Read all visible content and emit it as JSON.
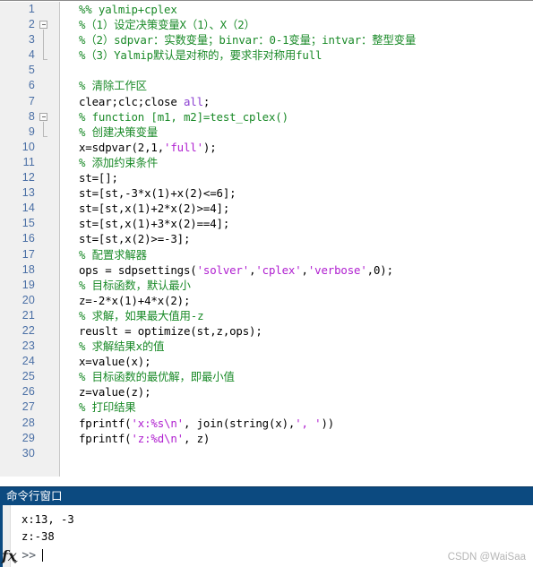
{
  "editor": {
    "first_line": 1,
    "last_line": 30,
    "total_lines": 30,
    "fold_markers": [
      2,
      8
    ],
    "lines": [
      {
        "n": 1,
        "tokens": [
          {
            "t": "%% yalmip+cplex",
            "c": "cm"
          }
        ]
      },
      {
        "n": 2,
        "tokens": [
          {
            "t": "%（1）设定决策变量X（1）、X（2）",
            "c": "cm"
          }
        ]
      },
      {
        "n": 3,
        "tokens": [
          {
            "t": "%（2）sdpvar：实数变量；binvar：0-1变量；intvar：整型变量",
            "c": "cm"
          }
        ]
      },
      {
        "n": 4,
        "tokens": [
          {
            "t": "%（3）Yalmip默认是对称的，要求非对称用full",
            "c": "cm"
          }
        ]
      },
      {
        "n": 5,
        "tokens": []
      },
      {
        "n": 6,
        "tokens": [
          {
            "t": "% 清除工作区",
            "c": "cm"
          }
        ]
      },
      {
        "n": 7,
        "tokens": [
          {
            "t": "clear;clc;close ",
            "c": "pl"
          },
          {
            "t": "all",
            "c": "kw"
          },
          {
            "t": ";",
            "c": "pl"
          }
        ]
      },
      {
        "n": 8,
        "tokens": [
          {
            "t": "% function [m1, m2]=test_cplex()",
            "c": "cm"
          }
        ]
      },
      {
        "n": 9,
        "tokens": [
          {
            "t": "% 创建决策变量",
            "c": "cm"
          }
        ]
      },
      {
        "n": 10,
        "tokens": [
          {
            "t": "x=sdpvar(2,1,",
            "c": "pl"
          },
          {
            "t": "'full'",
            "c": "st"
          },
          {
            "t": ");",
            "c": "pl"
          }
        ]
      },
      {
        "n": 11,
        "tokens": [
          {
            "t": "% 添加约束条件",
            "c": "cm"
          }
        ]
      },
      {
        "n": 12,
        "tokens": [
          {
            "t": "st=[];",
            "c": "pl"
          }
        ]
      },
      {
        "n": 13,
        "tokens": [
          {
            "t": "st=[st,-3*x(1)+x(2)<=6];",
            "c": "pl"
          }
        ]
      },
      {
        "n": 14,
        "tokens": [
          {
            "t": "st=[st,x(1)+2*x(2)>=4];",
            "c": "pl"
          }
        ]
      },
      {
        "n": 15,
        "tokens": [
          {
            "t": "st=[st,x(1)+3*x(2)==4];",
            "c": "pl"
          }
        ]
      },
      {
        "n": 16,
        "tokens": [
          {
            "t": "st=[st,x(2)>=-3];",
            "c": "pl"
          }
        ]
      },
      {
        "n": 17,
        "tokens": [
          {
            "t": "% 配置求解器",
            "c": "cm"
          }
        ]
      },
      {
        "n": 18,
        "tokens": [
          {
            "t": "ops = sdpsettings(",
            "c": "pl"
          },
          {
            "t": "'solver'",
            "c": "st"
          },
          {
            "t": ",",
            "c": "pl"
          },
          {
            "t": "'cplex'",
            "c": "st"
          },
          {
            "t": ",",
            "c": "pl"
          },
          {
            "t": "'verbose'",
            "c": "st"
          },
          {
            "t": ",0);",
            "c": "pl"
          }
        ]
      },
      {
        "n": 19,
        "tokens": [
          {
            "t": "% 目标函数，默认最小",
            "c": "cm"
          }
        ]
      },
      {
        "n": 20,
        "tokens": [
          {
            "t": "z=-2*x(1)+4*x(2);",
            "c": "pl"
          }
        ]
      },
      {
        "n": 21,
        "tokens": [
          {
            "t": "% 求解，如果最大值用-z",
            "c": "cm"
          }
        ]
      },
      {
        "n": 22,
        "tokens": [
          {
            "t": "reuslt = optimize(st,z,ops);",
            "c": "pl"
          }
        ]
      },
      {
        "n": 23,
        "tokens": [
          {
            "t": "% 求解结果x的值",
            "c": "cm"
          }
        ]
      },
      {
        "n": 24,
        "tokens": [
          {
            "t": "x=value(x);",
            "c": "pl"
          }
        ]
      },
      {
        "n": 25,
        "tokens": [
          {
            "t": "% 目标函数的最优解，即最小值",
            "c": "cm"
          }
        ]
      },
      {
        "n": 26,
        "tokens": [
          {
            "t": "z=value(z);",
            "c": "pl"
          }
        ]
      },
      {
        "n": 27,
        "tokens": [
          {
            "t": "% 打印结果",
            "c": "cm"
          }
        ]
      },
      {
        "n": 28,
        "tokens": [
          {
            "t": "fprintf(",
            "c": "pl"
          },
          {
            "t": "'x:%s\\n'",
            "c": "st"
          },
          {
            "t": ", join(string(x),",
            "c": "pl"
          },
          {
            "t": "', '",
            "c": "st"
          },
          {
            "t": "))",
            "c": "pl"
          }
        ]
      },
      {
        "n": 29,
        "tokens": [
          {
            "t": "fprintf(",
            "c": "pl"
          },
          {
            "t": "'z:%d\\n'",
            "c": "st"
          },
          {
            "t": ", z)",
            "c": "pl"
          }
        ]
      },
      {
        "n": 30,
        "tokens": []
      }
    ]
  },
  "command_window": {
    "title": "命令行窗口",
    "output_lines": [
      "x:13, -3",
      "z:-38"
    ],
    "prompt_symbol": ">>",
    "fx_label": "fx"
  },
  "watermark": {
    "text": "CSDN @WaiSaa"
  },
  "colors": {
    "comment_green": "#1a8a28",
    "string_magenta": "#b020d0",
    "keyword_purple": "#8b3fd1",
    "titlebar_blue": "#0c4a80",
    "linenumber_blue": "#4a6fa5",
    "gutter_gray": "#f0f0f0"
  }
}
